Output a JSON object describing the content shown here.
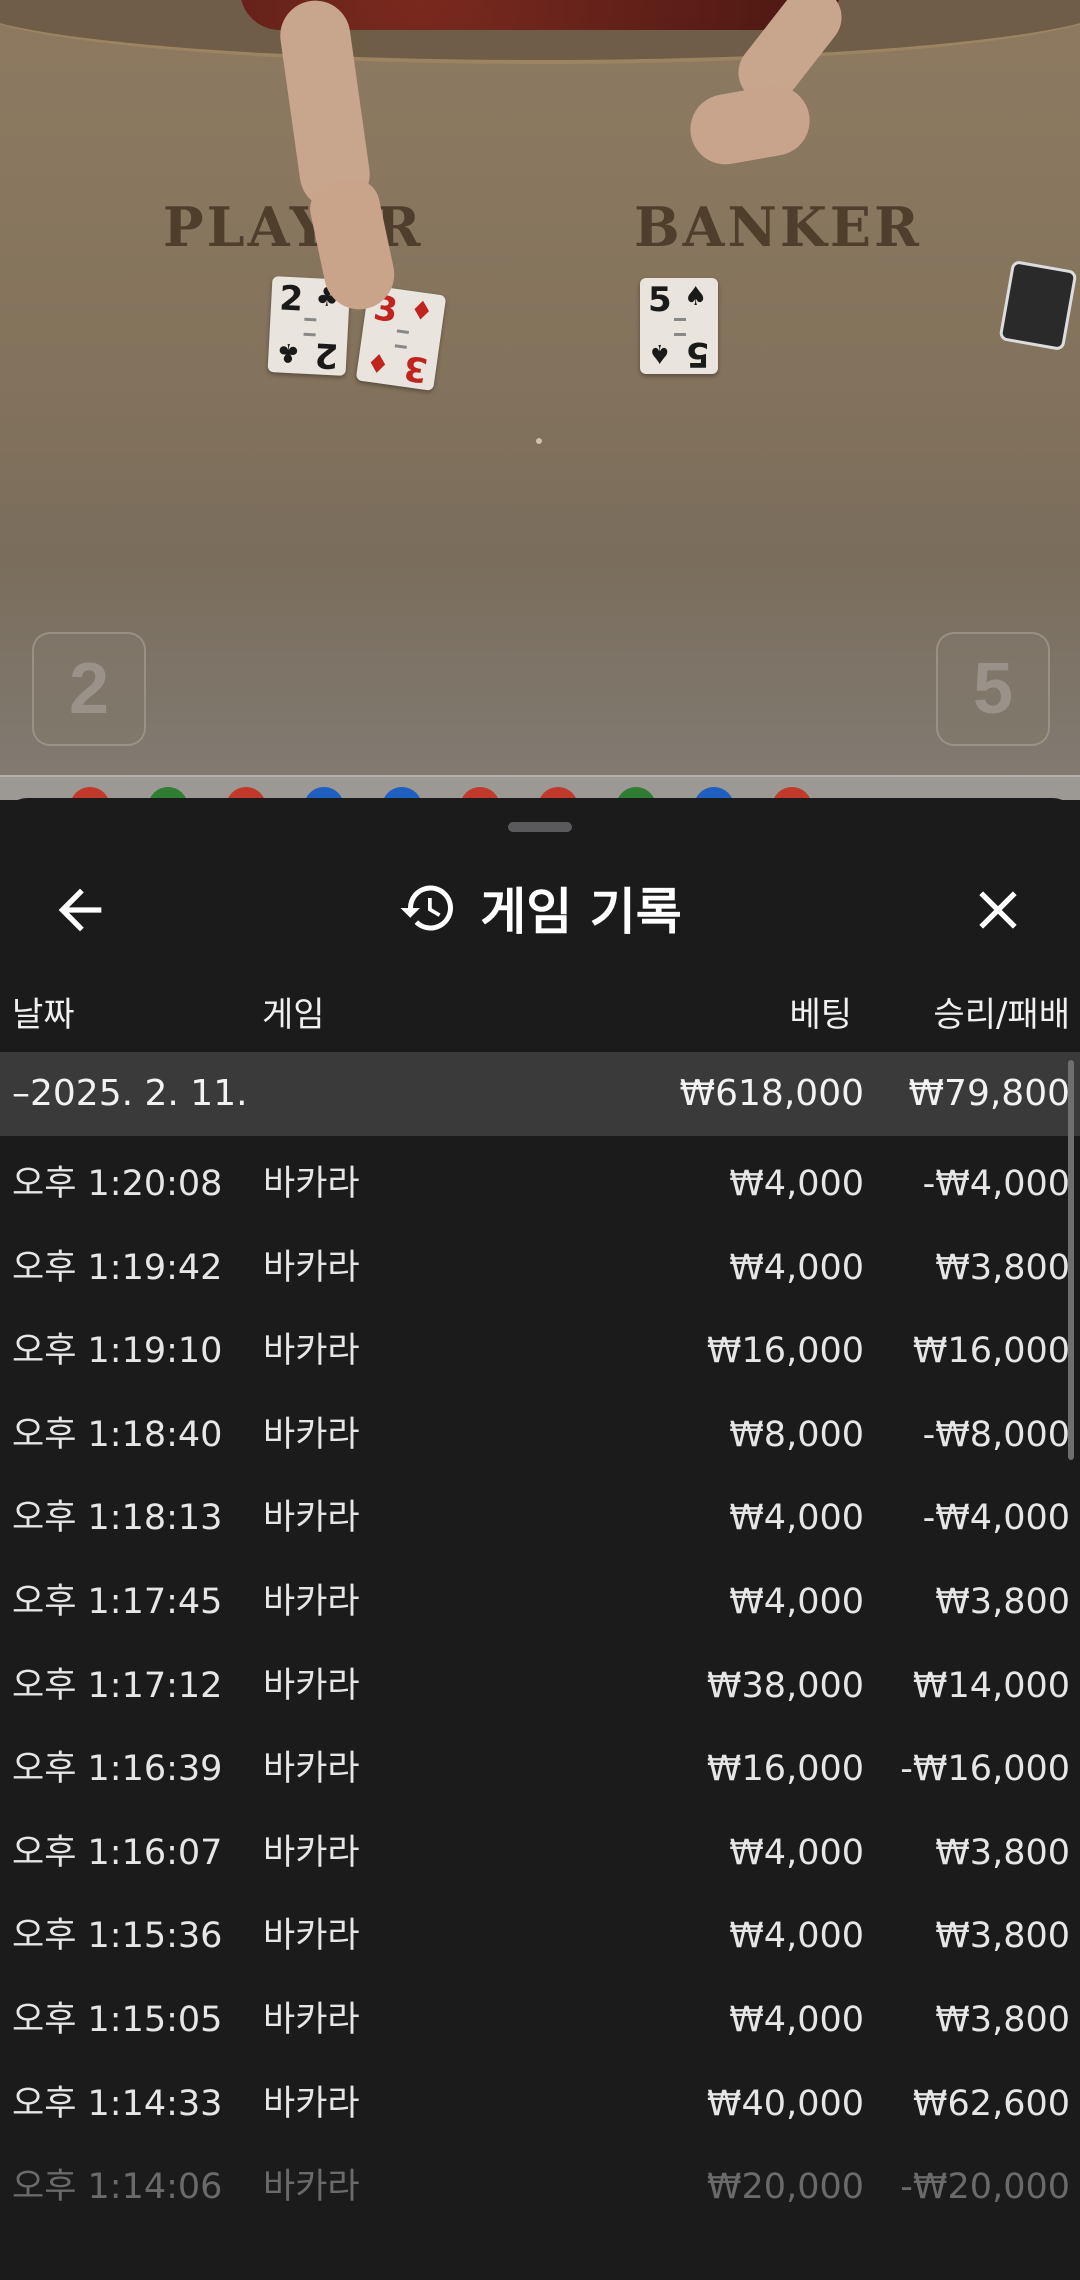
{
  "video": {
    "player_label": "PLAYER",
    "banker_label": "BANKER",
    "player_score": "2",
    "banker_score": "5",
    "player_cards": [
      {
        "rank": "2",
        "suit": "♣",
        "color": "black"
      },
      {
        "rank": "3",
        "suit": "♦",
        "color": "red"
      }
    ],
    "banker_cards": [
      {
        "rank": "5",
        "suit": "♠",
        "color": "black"
      }
    ]
  },
  "sheet": {
    "title": "게임 기록",
    "back_icon": "arrow-left-icon",
    "history_icon": "history-icon",
    "close_icon": "close-icon",
    "columns": {
      "date": "날짜",
      "game": "게임",
      "bet": "베팅",
      "result": "승리/패배"
    },
    "summary": {
      "date": "–2025. 2. 11.",
      "bet": "₩618,000",
      "result": "₩79,800"
    },
    "rows": [
      {
        "time": "오후 1:20:08",
        "game": "바카라",
        "bet": "₩4,000",
        "result": "-₩4,000"
      },
      {
        "time": "오후 1:19:42",
        "game": "바카라",
        "bet": "₩4,000",
        "result": "₩3,800"
      },
      {
        "time": "오후 1:19:10",
        "game": "바카라",
        "bet": "₩16,000",
        "result": "₩16,000"
      },
      {
        "time": "오후 1:18:40",
        "game": "바카라",
        "bet": "₩8,000",
        "result": "-₩8,000"
      },
      {
        "time": "오후 1:18:13",
        "game": "바카라",
        "bet": "₩4,000",
        "result": "-₩4,000"
      },
      {
        "time": "오후 1:17:45",
        "game": "바카라",
        "bet": "₩4,000",
        "result": "₩3,800"
      },
      {
        "time": "오후 1:17:12",
        "game": "바카라",
        "bet": "₩38,000",
        "result": "₩14,000"
      },
      {
        "time": "오후 1:16:39",
        "game": "바카라",
        "bet": "₩16,000",
        "result": "-₩16,000"
      },
      {
        "time": "오후 1:16:07",
        "game": "바카라",
        "bet": "₩4,000",
        "result": "₩3,800"
      },
      {
        "time": "오후 1:15:36",
        "game": "바카라",
        "bet": "₩4,000",
        "result": "₩3,800"
      },
      {
        "time": "오후 1:15:05",
        "game": "바카라",
        "bet": "₩4,000",
        "result": "₩3,800"
      },
      {
        "time": "오후 1:14:33",
        "game": "바카라",
        "bet": "₩40,000",
        "result": "₩62,600"
      },
      {
        "time": "오후 1:14:06",
        "game": "바카라",
        "bet": "₩20,000",
        "result": "-₩20,000"
      }
    ]
  },
  "colors": {
    "sheet_bg": "#1b1b1c",
    "summary_bg": "#3a3a3b",
    "text": "#e6e6e6",
    "roadmap_dots": [
      "#c0392b",
      "#2e7d32",
      "#c0392b",
      "#1f5fbf",
      "#1f5fbf",
      "#c0392b",
      "#c0392b",
      "#2e7d32",
      "#1f5fbf",
      "#c0392b"
    ]
  }
}
